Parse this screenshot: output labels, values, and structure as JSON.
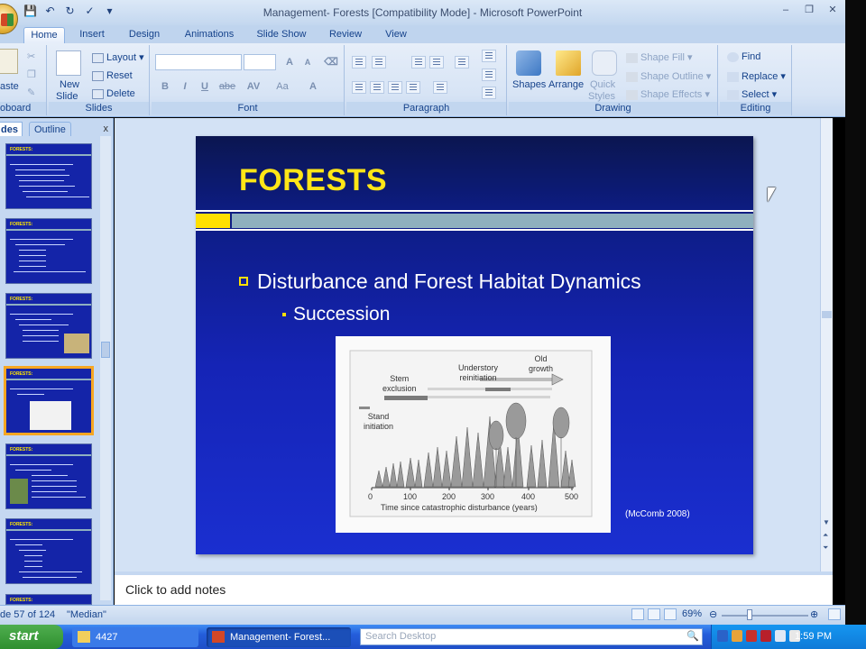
{
  "window": {
    "title": "Management- Forests [Compatibility Mode] - Microsoft PowerPoint"
  },
  "ribbon": {
    "tabs": [
      "Home",
      "Insert",
      "Design",
      "Animations",
      "Slide Show",
      "Review",
      "View"
    ],
    "groups": {
      "clipboard": {
        "label": "oboard",
        "paste_label": "aste"
      },
      "slides": {
        "label": "Slides",
        "new_slide_line1": "New",
        "new_slide_line2": "Slide",
        "layout": "Layout",
        "reset": "Reset",
        "delete": "Delete"
      },
      "font": {
        "label": "Font",
        "grow": "A",
        "shrink": "A",
        "bold": "B",
        "italic": "I",
        "underline": "U",
        "strike": "abe",
        "spacing": "AV",
        "case": "Aa",
        "color": "A"
      },
      "paragraph": {
        "label": "Paragraph"
      },
      "drawing": {
        "label": "Drawing",
        "shapes": "Shapes",
        "arrange": "Arrange",
        "quick_line1": "Quick",
        "quick_line2": "Styles",
        "shape_fill": "Shape Fill",
        "shape_outline": "Shape Outline",
        "shape_effects": "Shape Effects"
      },
      "editing": {
        "label": "Editing",
        "find": "Find",
        "replace": "Replace",
        "select": "Select"
      }
    }
  },
  "panel": {
    "tabs": [
      "des",
      "Outline"
    ],
    "close": "x",
    "thumbnails": [
      {
        "title": "FORESTS:",
        "selected": false
      },
      {
        "title": "FORESTS:",
        "selected": false
      },
      {
        "title": "FORESTS:",
        "selected": false
      },
      {
        "title": "FORESTS:",
        "selected": true
      },
      {
        "title": "FORESTS:",
        "selected": false
      },
      {
        "title": "FORESTS:",
        "selected": false
      },
      {
        "title": "FORESTS:",
        "selected": false
      }
    ]
  },
  "slide": {
    "title": "FORESTS",
    "bullet_1": "Disturbance and Forest Habitat Dynamics",
    "bullet_2": "Succession",
    "citation": "(McComb 2008)",
    "figure": {
      "stage_stand_line1": "Stand",
      "stage_stand_line2": "initiation",
      "stage_stem_line1": "Stem",
      "stage_stem_line2": "exclusion",
      "stage_under_line1": "Understory",
      "stage_under_line2": "reinitiation",
      "stage_old_line1": "Old",
      "stage_old_line2": "growth",
      "x_ticks": [
        "0",
        "100",
        "200",
        "300",
        "400",
        "500"
      ],
      "x_label": "Time since catastrophic disturbance (years)"
    }
  },
  "notes": {
    "placeholder": "Click to add notes"
  },
  "status": {
    "slide_counter": "de 57 of 124",
    "theme": "\"Median\"",
    "zoom": "69%"
  },
  "taskbar": {
    "start": "start",
    "folder_task": "4427",
    "ppt_task": "Management- Forest...",
    "search_placeholder": "Search Desktop",
    "clock": "1:59 PM"
  },
  "colors": {
    "slide_title": "#ffe617",
    "slide_bg": "#1524b6",
    "accent_yellow": "#ffe000",
    "accent_teal": "#8fb0be"
  }
}
